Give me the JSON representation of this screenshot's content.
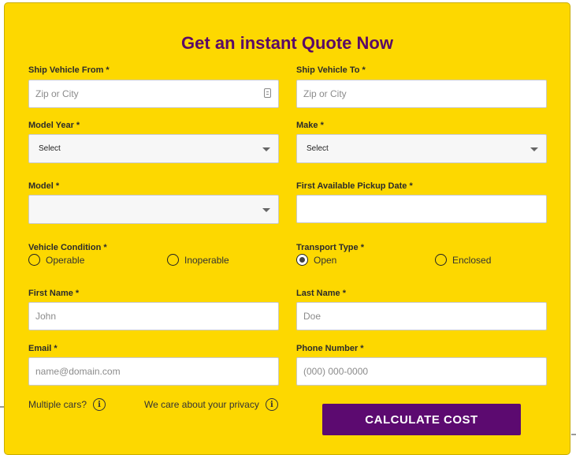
{
  "form": {
    "title": "Get an instant Quote Now",
    "ship_from": {
      "label": "Ship Vehicle From *",
      "placeholder": "Zip or City"
    },
    "ship_to": {
      "label": "Ship Vehicle To *",
      "placeholder": "Zip or City"
    },
    "model_year": {
      "label": "Model Year *",
      "value": "Select"
    },
    "make": {
      "label": "Make *",
      "value": "Select"
    },
    "model": {
      "label": "Model *",
      "value": ""
    },
    "pickup_date": {
      "label": "First Available Pickup Date *",
      "value": ""
    },
    "vehicle_condition": {
      "label": "Vehicle Condition *",
      "options": [
        "Operable",
        "Inoperable"
      ],
      "selected": null
    },
    "transport_type": {
      "label": "Transport Type *",
      "options": [
        "Open",
        "Enclosed"
      ],
      "selected": "Open"
    },
    "first_name": {
      "label": "First Name *",
      "placeholder": "John"
    },
    "last_name": {
      "label": "Last Name *",
      "placeholder": "Doe"
    },
    "email": {
      "label": "Email *",
      "placeholder": "name@domain.com"
    },
    "phone": {
      "label": "Phone Number *",
      "placeholder": "(000) 000-0000"
    },
    "multiple_cars": "Multiple cars?",
    "privacy": "We care about your privacy",
    "submit": "CALCULATE COST",
    "colors": {
      "background": "#fdd800",
      "accent": "#5c0a70"
    },
    "icons": {
      "info": "info-icon",
      "dropdown": "chevron-down-icon",
      "contact": "contact-card-icon"
    }
  }
}
